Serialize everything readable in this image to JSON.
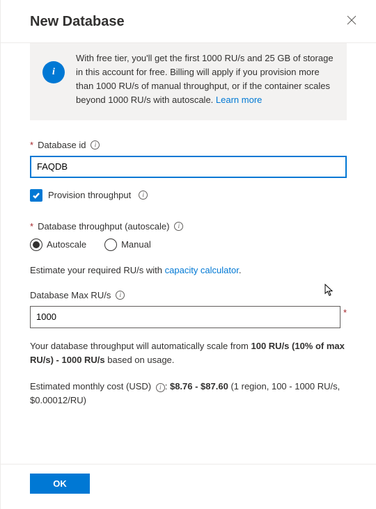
{
  "header": {
    "title": "New Database"
  },
  "infoBox": {
    "text": "With free tier, you'll get the first 1000 RU/s and 25 GB of storage in this account for free. Billing will apply if you provision more than 1000 RU/s of manual throughput, or if the container scales beyond 1000 RU/s with autoscale. ",
    "link_label": "Learn more"
  },
  "form": {
    "db_id_label": "Database id",
    "db_id_value": "FAQDB",
    "provision_label": "Provision throughput",
    "throughput_label": "Database throughput (autoscale)",
    "radio_autoscale": "Autoscale",
    "radio_manual": "Manual",
    "estimate_text_before": "Estimate your required RU/s with ",
    "estimate_link": "capacity calculator",
    "max_ru_label": "Database Max RU/s",
    "max_ru_value": "1000",
    "scale_text_1": "Your database throughput will automatically scale from ",
    "scale_text_bold": "100 RU/s (10% of max RU/s) - 1000 RU/s",
    "scale_text_2": " based on usage.",
    "cost_label": "Estimated monthly cost (USD)",
    "cost_bold": "$8.76 - $87.60",
    "cost_detail": " (1 region, 100 - 1000 RU/s, $0.00012/RU)"
  },
  "footer": {
    "ok_label": "OK"
  }
}
